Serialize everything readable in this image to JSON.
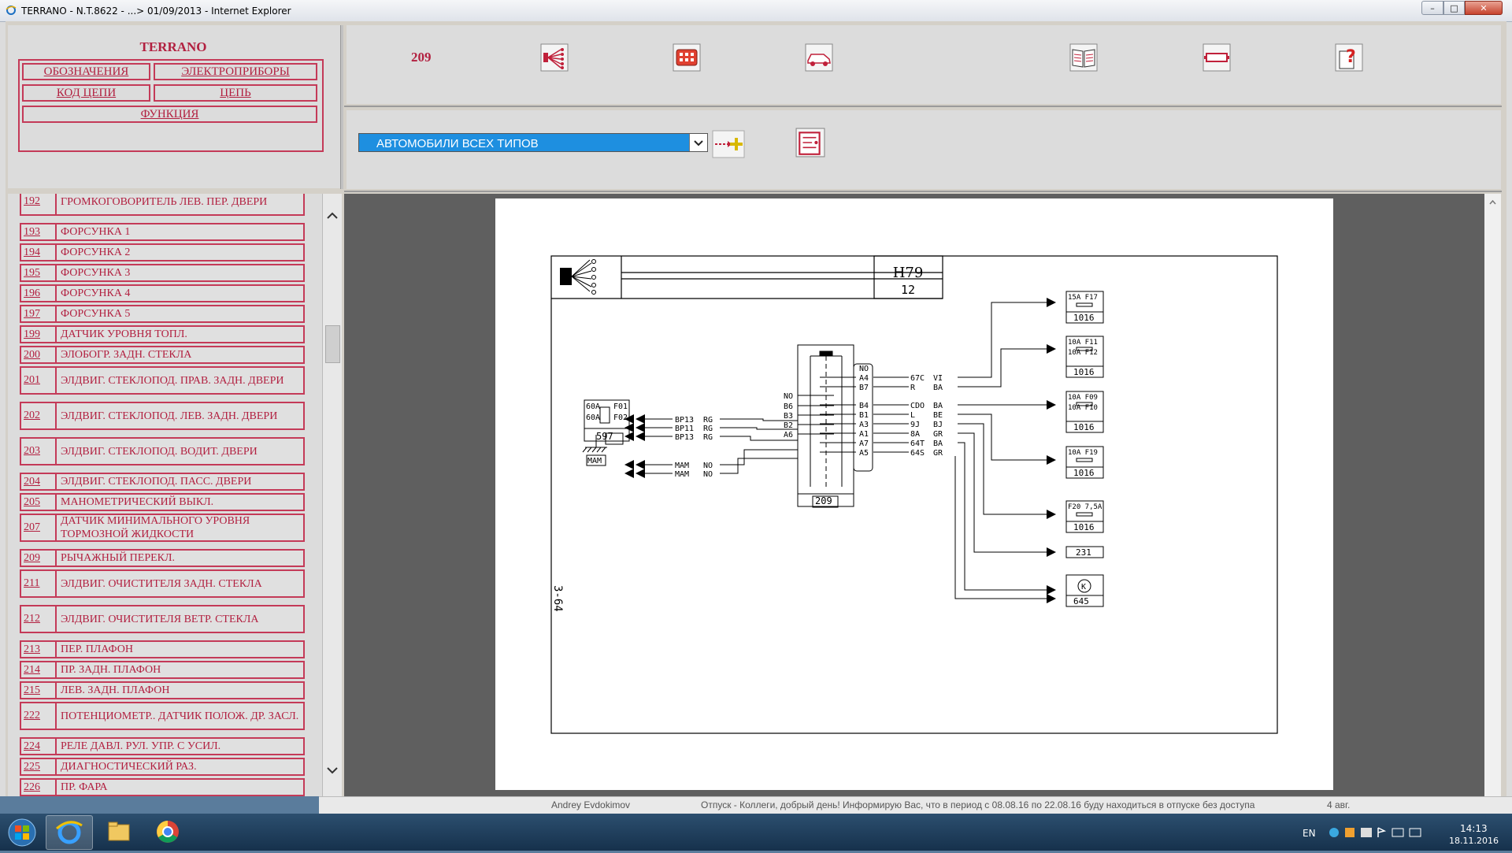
{
  "window": {
    "title": "TERRANO - N.T.8622 - ...> 01/09/2013 - Internet Explorer",
    "min": "–",
    "max": "□",
    "close": "✕"
  },
  "nav": {
    "title": "TERRANO",
    "links": {
      "designations": "ОБОЗНАЧЕНИЯ",
      "devices": "ЭЛЕКТРОПРИБОРЫ",
      "circuit_code": "КОД ЦЕПИ",
      "circuit": "ЦЕПЬ",
      "function": "ФУНКЦИЯ"
    }
  },
  "toolbar": {
    "number": "209",
    "icons": [
      "wiring-harness-icon",
      "connector-icon",
      "vehicle-icon",
      "book-icon",
      "fuse-icon",
      "help-icon"
    ],
    "vehicle_select": "АВТОМОБИЛИ ВСЕХ ТИПОВ",
    "add_icon": "arrow-add-icon",
    "print_icon": "circuit-diagram-icon"
  },
  "list": [
    {
      "num": "192",
      "label": "ГРОМКОГОВОРИТЕЛЬ ЛЕВ. ПЕР. ДВЕРИ"
    },
    {
      "num": "193",
      "label": "ФОРСУНКА 1"
    },
    {
      "num": "194",
      "label": "ФОРСУНКА 2"
    },
    {
      "num": "195",
      "label": "ФОРСУНКА 3"
    },
    {
      "num": "196",
      "label": "ФОРСУНКА 4"
    },
    {
      "num": "197",
      "label": "ФОРСУНКА 5"
    },
    {
      "num": "199",
      "label": "ДАТЧИК УРОВНЯ ТОПЛ."
    },
    {
      "num": "200",
      "label": "ЭЛОБОГР. ЗАДН. СТЕКЛА"
    },
    {
      "num": "201",
      "label": "ЭЛДВИГ. СТЕКЛОПОД. ПРАВ. ЗАДН. ДВЕРИ"
    },
    {
      "num": "202",
      "label": "ЭЛДВИГ. СТЕКЛОПОД. ЛЕВ. ЗАДН. ДВЕРИ"
    },
    {
      "num": "203",
      "label": "ЭЛДВИГ. СТЕКЛОПОД. ВОДИТ. ДВЕРИ"
    },
    {
      "num": "204",
      "label": "ЭЛДВИГ. СТЕКЛОПОД. ПАСС. ДВЕРИ"
    },
    {
      "num": "205",
      "label": "МАНОМЕТРИЧЕСКИЙ ВЫКЛ."
    },
    {
      "num": "207",
      "label": "ДАТЧИК МИНИМАЛЬНОГО УРОВНЯ ТОРМОЗНОЙ ЖИДКОСТИ"
    },
    {
      "num": "209",
      "label": "РЫЧАЖНЫЙ ПЕРЕКЛ."
    },
    {
      "num": "211",
      "label": "ЭЛДВИГ. ОЧИСТИТЕЛЯ ЗАДН. СТЕКЛА"
    },
    {
      "num": "212",
      "label": "ЭЛДВИГ. ОЧИСТИТЕЛЯ ВЕТР. СТЕКЛА"
    },
    {
      "num": "213",
      "label": "ПЕР. ПЛАФОН"
    },
    {
      "num": "214",
      "label": "ПР. ЗАДН. ПЛАФОН"
    },
    {
      "num": "215",
      "label": "ЛЕВ. ЗАДН. ПЛАФОН"
    },
    {
      "num": "222",
      "label": "ПОТЕНЦИОМЕТР.. ДАТЧИК ПОЛОЖ. ДР. ЗАСЛ."
    },
    {
      "num": "224",
      "label": "РЕЛЕ ДАВЛ. РУЛ. УПР. С УСИЛ."
    },
    {
      "num": "225",
      "label": "ДИАГНОСТИЧЕСКИЙ РАЗ."
    },
    {
      "num": "226",
      "label": "ПР. ФАРА"
    }
  ],
  "diagram": {
    "header_code": "H79",
    "header_num": "12",
    "page_ref": "3-64",
    "left_fuse": {
      "rows": [
        "60A",
        "60A"
      ],
      "ids": [
        "F01",
        "F02"
      ],
      "code": "597"
    },
    "ground": "MAM",
    "left_wires": [
      {
        "code": "BP13",
        "color": "RG"
      },
      {
        "code": "BP11",
        "color": "RG"
      },
      {
        "code": "BP13",
        "color": "RG"
      },
      {
        "code": "MAM",
        "color": "NO"
      },
      {
        "code": "MAM",
        "color": "NO"
      }
    ],
    "switch_left_pins": [
      "NO",
      "B6",
      "B3",
      "B2",
      "A6"
    ],
    "switch_code": "209",
    "switch_right_pins": [
      "NO",
      "A4",
      "B7",
      "B4",
      "B1",
      "A3",
      "A1",
      "A7",
      "A5"
    ],
    "right_wires": [
      {
        "code": "67C",
        "color": "VI"
      },
      {
        "code": "R",
        "color": "BA"
      },
      {
        "code": "CDO",
        "color": "BA"
      },
      {
        "code": "L",
        "color": "BE"
      },
      {
        "code": "9J",
        "color": "BJ"
      },
      {
        "code": "8A",
        "color": "GR"
      },
      {
        "code": "64T",
        "color": "BA"
      },
      {
        "code": "64S",
        "color": "GR"
      }
    ],
    "right_boxes": [
      {
        "top": "15A F17",
        "code": "1016"
      },
      {
        "top": "10A F11",
        "top2": "10A F12",
        "code": "1016"
      },
      {
        "top": "10A F09",
        "top2": "10A F10",
        "code": "1016"
      },
      {
        "top": "10A F19",
        "code": "1016"
      },
      {
        "top": "F20 7,5A",
        "code": "1016"
      },
      {
        "top": "",
        "code": "231"
      },
      {
        "top": "K",
        "code": "645"
      }
    ]
  },
  "status_strip": {
    "name": "Andrey Evdokimov",
    "message": "Отпуск - Коллеги, добрый день! Информирую Вас, что в период с 08.08.16 по 22.08.16 буду находиться в отпуске без доступа",
    "date": "4 авг."
  },
  "taskbar": {
    "lang": "EN",
    "time": "14:13",
    "date": "18.11.2016"
  }
}
